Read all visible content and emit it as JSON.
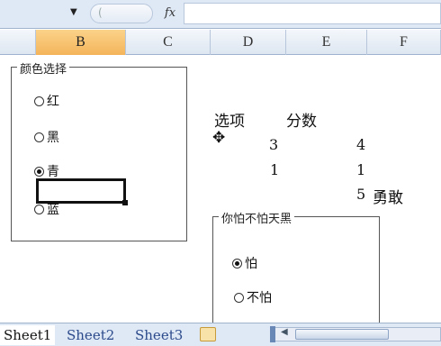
{
  "formula_bar": {
    "namebox_arrow": "▼",
    "cancel_glyph": "(",
    "fx_label": "fx"
  },
  "columns": [
    "B",
    "C",
    "D",
    "E",
    "F"
  ],
  "selected_column": "B",
  "color_group": {
    "legend": "颜色选择",
    "options": [
      {
        "label": "红",
        "checked": false
      },
      {
        "label": "黑",
        "checked": false
      },
      {
        "label": "青",
        "checked": true
      },
      {
        "label": "蓝",
        "checked": false
      }
    ]
  },
  "cells": {
    "header_option": "选项",
    "header_score": "分数",
    "r1_option": "3",
    "r1_score": "4",
    "r2_option": "1",
    "r2_score": "1",
    "r3_score": "5",
    "r3_text": "勇敢"
  },
  "fear_group": {
    "legend": "你怕不怕天黑",
    "options": [
      {
        "label": "怕",
        "checked": true
      },
      {
        "label": "不怕",
        "checked": false
      }
    ]
  },
  "sheet_tabs": [
    "Sheet1",
    "Sheet2",
    "Sheet3"
  ],
  "active_sheet": "Sheet1",
  "cursor_icon": "move-cross-icon"
}
